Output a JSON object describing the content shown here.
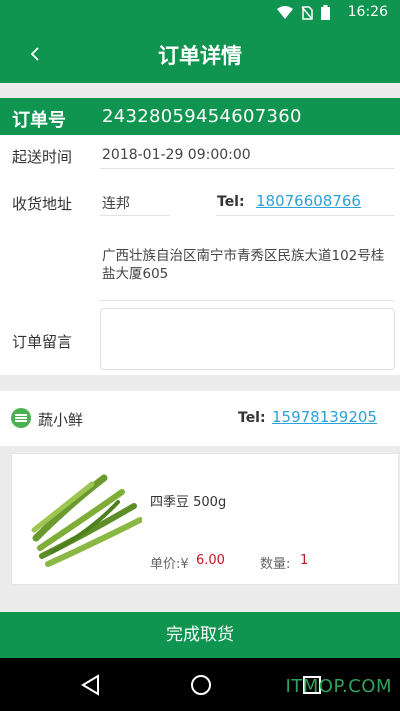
{
  "status_bar": {
    "time": "16:26"
  },
  "header": {
    "title": "订单详情"
  },
  "order": {
    "number_label": "订单号",
    "number": "24328059454607360",
    "delivery_time_label": "起送时间",
    "delivery_time": "2018-01-29 09:00:00",
    "address_label": "收货地址",
    "recipient": "连邦",
    "tel_label": "Tel:",
    "recipient_tel": "18076608766",
    "address": "广西壮族自治区南宁市青秀区民族大道102号桂盐大厦605",
    "remark_label": "订单留言",
    "remark": ""
  },
  "shop": {
    "name": "蔬小鲜",
    "tel_label": "Tel:",
    "tel": "15978139205",
    "icon": "vegetable-shop-icon"
  },
  "goods": [
    {
      "name": "四季豆 500g",
      "price_label": "单价:¥",
      "price": "6.00",
      "qty_label": "数量:",
      "qty": "1",
      "image": "green-beans"
    }
  ],
  "actions": {
    "complete_label": "完成取货"
  },
  "watermark": "ITMOP.COM",
  "colors": {
    "primary": "#0f9550",
    "link": "#2ea1d8",
    "price": "#c0181f"
  }
}
